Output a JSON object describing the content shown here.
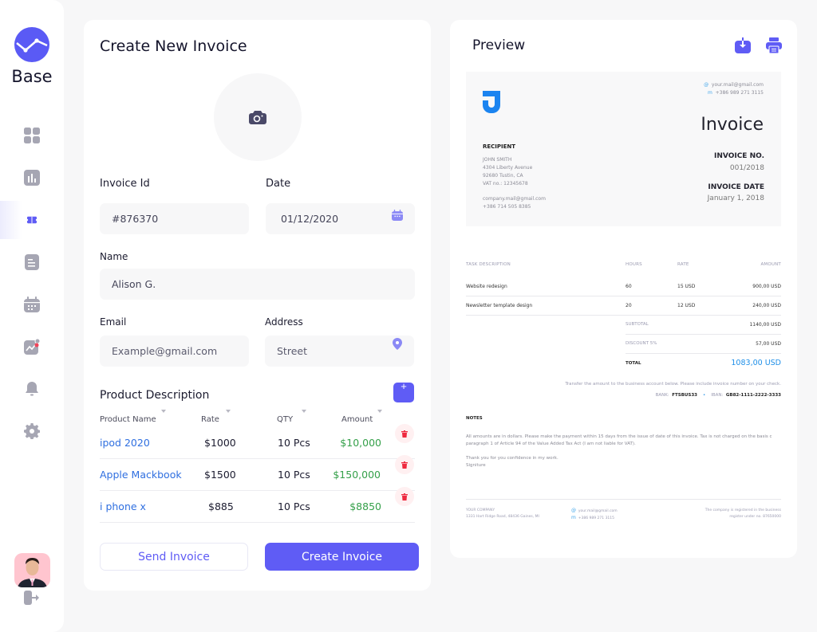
{
  "app": {
    "brand": "Base",
    "accent": "#5f5cf5"
  },
  "sidebar": {
    "items": [
      {
        "id": "dashboard",
        "icon": "grid-icon",
        "active": false
      },
      {
        "id": "analytics",
        "icon": "bar-chart-icon",
        "active": false
      },
      {
        "id": "invoices",
        "icon": "ticket-icon",
        "active": true
      },
      {
        "id": "documents",
        "icon": "document-icon",
        "active": false
      },
      {
        "id": "calendar",
        "icon": "calendar-icon",
        "active": false
      },
      {
        "id": "reports",
        "icon": "trend-chart-icon",
        "active": false
      },
      {
        "id": "notifications",
        "icon": "bell-icon",
        "active": false
      },
      {
        "id": "settings",
        "icon": "gear-icon",
        "active": false
      }
    ]
  },
  "form": {
    "title": "Create New Invoice",
    "invoice_id": {
      "label": "Invoice Id",
      "value": "#876370"
    },
    "date": {
      "label": "Date",
      "value": "01/12/2020"
    },
    "name": {
      "label": "Name",
      "value": "Alison G."
    },
    "email": {
      "label": "Email",
      "placeholder": "Example@gmail.com"
    },
    "address": {
      "label": "Address",
      "placeholder": "Street"
    },
    "products": {
      "title": "Product Description",
      "add_label": "+",
      "columns": [
        "Product Name",
        "Rate",
        "QTY",
        "Amount"
      ],
      "rows": [
        {
          "name": "ipod 2020",
          "rate": "$1000",
          "qty": "10 Pcs",
          "amount": "$10,000"
        },
        {
          "name": "Apple Mackbook",
          "rate": "$1500",
          "qty": "10 Pcs",
          "amount": "$150,000"
        },
        {
          "name": "i phone x",
          "rate": "$885",
          "qty": "10 Pcs",
          "amount": "$8850"
        }
      ]
    },
    "send_label": "Send Invoice",
    "create_label": "Create Invoice"
  },
  "preview": {
    "title": "Preview",
    "logo_letter": "J",
    "contact": {
      "email": "your.mail@gmail.com",
      "phone": "+386 989 271 3115"
    },
    "doc_title": "Invoice",
    "recipient": {
      "heading": "RECIPIENT",
      "lines": [
        "JOHN SMITH",
        "4304 Liberty Avenue",
        "92680 Tustin, CA",
        "VAT no.: 12345678"
      ],
      "email": "company.mail@gmail.com",
      "phone": "+386 714 505 8385"
    },
    "invoice_no": {
      "label": "INVOICE NO.",
      "value": "001/2018"
    },
    "invoice_date": {
      "label": "INVOICE DATE",
      "value": "January 1, 2018"
    },
    "table": {
      "headers": [
        "TASK DESCRIPTION",
        "HOURS",
        "RATE",
        "AMOUNT"
      ],
      "rows": [
        {
          "task": "Website redesign",
          "hours": "60",
          "rate": "15 USD",
          "amount": "900,00 USD"
        },
        {
          "task": "Newsletter template design",
          "hours": "20",
          "rate": "12 USD",
          "amount": "240,00 USD"
        }
      ],
      "subtotal": {
        "label": "SUBTOTAL",
        "value": "1140,00 USD"
      },
      "discount": {
        "label": "DISCOUNT 5%",
        "value": "57,00 USD"
      },
      "total": {
        "label": "TOTAL",
        "value": "1083,00 USD"
      }
    },
    "transfer_note": "Transfer the amount to the business account below. Please include invoice number on your check.",
    "bank": {
      "label": "BANK:",
      "value": "FTSBUS33"
    },
    "iban": {
      "label": "IBAN:",
      "value": "GB82-1111-2222-3333"
    },
    "notes": {
      "heading": "NOTES",
      "line1": "All amounts are in dollars. Please make the payment within 15 days from the issue of date of this invoice. Tax is not charged on the basis c",
      "line2": "paragraph 1 of Article 94 of the Value Added Tax Act (I am not liable for VAT).",
      "line3": "Thank you for you confidence in my work.",
      "line4": "Signiture"
    },
    "footer": {
      "company": "YOUR COMPANY",
      "address": "1331 Hart Ridge Road, 48436 Gaines, MI",
      "email": "your.mail@gmail.com",
      "phone": "+386 989 271 3115",
      "reg1": "The company is registered in the business",
      "reg2": "register under no. 87650000"
    }
  }
}
